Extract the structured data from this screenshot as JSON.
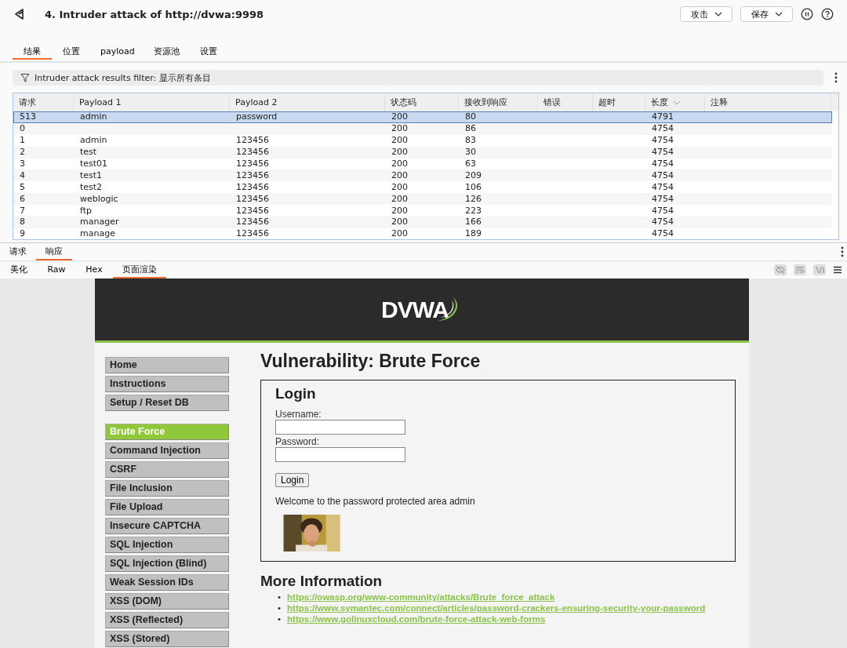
{
  "window": {
    "title": "4. Intruder attack of http://dvwa:9998"
  },
  "header_buttons": [
    {
      "label": "攻击"
    },
    {
      "label": "保存"
    }
  ],
  "tabs": [
    {
      "label": "结果",
      "selected": true
    },
    {
      "label": "位置",
      "selected": false
    },
    {
      "label": "payload",
      "selected": false
    },
    {
      "label": "资源池",
      "selected": false
    },
    {
      "label": "设置",
      "selected": false
    }
  ],
  "filter": {
    "text": "Intruder attack results filter: 显示所有条目"
  },
  "table": {
    "columns": [
      {
        "label": "请求",
        "sorted": false
      },
      {
        "label": "Payload 1",
        "sorted": false
      },
      {
        "label": "Payload 2",
        "sorted": false
      },
      {
        "label": "状态码",
        "sorted": false
      },
      {
        "label": "接收到响应",
        "sorted": false
      },
      {
        "label": "错误",
        "sorted": false
      },
      {
        "label": "超时",
        "sorted": false
      },
      {
        "label": "长度",
        "sorted": true
      },
      {
        "label": "注释",
        "sorted": false
      }
    ],
    "rows": [
      {
        "cells": [
          "513",
          "admin",
          "password",
          "200",
          "80",
          "",
          "",
          "4791",
          ""
        ],
        "selected": true
      },
      {
        "cells": [
          "0",
          "",
          "",
          "200",
          "86",
          "",
          "",
          "4754",
          ""
        ],
        "selected": false
      },
      {
        "cells": [
          "1",
          "admin",
          "123456",
          "200",
          "83",
          "",
          "",
          "4754",
          ""
        ],
        "selected": false
      },
      {
        "cells": [
          "2",
          "test",
          "123456",
          "200",
          "30",
          "",
          "",
          "4754",
          ""
        ],
        "selected": false
      },
      {
        "cells": [
          "3",
          "test01",
          "123456",
          "200",
          "63",
          "",
          "",
          "4754",
          ""
        ],
        "selected": false
      },
      {
        "cells": [
          "4",
          "test1",
          "123456",
          "200",
          "209",
          "",
          "",
          "4754",
          ""
        ],
        "selected": false
      },
      {
        "cells": [
          "5",
          "test2",
          "123456",
          "200",
          "106",
          "",
          "",
          "4754",
          ""
        ],
        "selected": false
      },
      {
        "cells": [
          "6",
          "weblogic",
          "123456",
          "200",
          "126",
          "",
          "",
          "4754",
          ""
        ],
        "selected": false
      },
      {
        "cells": [
          "7",
          "ftp",
          "123456",
          "200",
          "223",
          "",
          "",
          "4754",
          ""
        ],
        "selected": false
      },
      {
        "cells": [
          "8",
          "manager",
          "123456",
          "200",
          "166",
          "",
          "",
          "4754",
          ""
        ],
        "selected": false
      },
      {
        "cells": [
          "9",
          "manage",
          "123456",
          "200",
          "189",
          "",
          "",
          "4754",
          ""
        ],
        "selected": false
      }
    ]
  },
  "message_tabs": [
    {
      "label": "请求",
      "selected": false
    },
    {
      "label": "响应",
      "selected": true
    }
  ],
  "view_tabs": [
    {
      "label": "美化",
      "selected": false
    },
    {
      "label": "Raw",
      "selected": false
    },
    {
      "label": "Hex",
      "selected": false
    },
    {
      "label": "页面渲染",
      "selected": true
    }
  ],
  "render": {
    "logo": "DVWA",
    "menu_groups": [
      [
        {
          "label": "Home",
          "selected": false
        },
        {
          "label": "Instructions",
          "selected": false
        },
        {
          "label": "Setup / Reset DB",
          "selected": false
        }
      ],
      [
        {
          "label": "Brute Force",
          "selected": true
        },
        {
          "label": "Command Injection",
          "selected": false
        },
        {
          "label": "CSRF",
          "selected": false
        },
        {
          "label": "File Inclusion",
          "selected": false
        },
        {
          "label": "File Upload",
          "selected": false
        },
        {
          "label": "Insecure CAPTCHA",
          "selected": false
        },
        {
          "label": "SQL Injection",
          "selected": false
        },
        {
          "label": "SQL Injection (Blind)",
          "selected": false
        },
        {
          "label": "Weak Session IDs",
          "selected": false
        },
        {
          "label": "XSS (DOM)",
          "selected": false
        },
        {
          "label": "XSS (Reflected)",
          "selected": false
        },
        {
          "label": "XSS (Stored)",
          "selected": false
        }
      ]
    ],
    "heading": "Vulnerability: Brute Force",
    "login": {
      "title": "Login",
      "username_label": "Username:",
      "password_label": "Password:",
      "button": "Login",
      "message": "Welcome to the password protected area admin"
    },
    "more_heading": "More Information",
    "links": [
      {
        "bullet": "•",
        "url": "https://owasp.org/www-community/attacks/Brute_force_attack"
      },
      {
        "bullet": "•",
        "url": "https://www.symantec.com/connect/articles/password-crackers-ensuring-security-your-password"
      },
      {
        "bullet": "•",
        "url": "https://www.golinuxcloud.com/brute-force-attack-web-forms"
      }
    ]
  }
}
